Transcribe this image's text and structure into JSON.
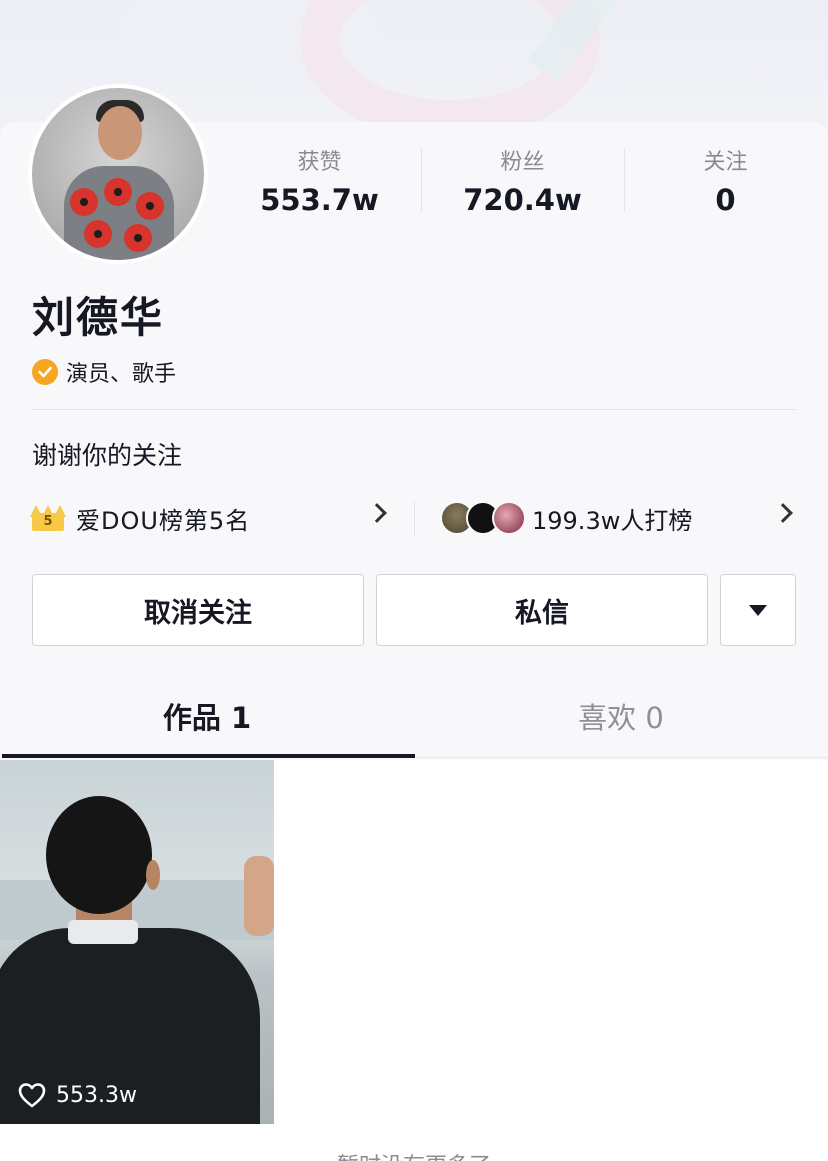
{
  "profile": {
    "name": "刘德华",
    "verification": "演员、歌手",
    "bio": "谢谢你的关注"
  },
  "stats": [
    {
      "label": "获赞",
      "value": "553.7w"
    },
    {
      "label": "粉丝",
      "value": "720.4w"
    },
    {
      "label": "关注",
      "value": "0"
    }
  ],
  "rank": {
    "badge_number": "5",
    "text": "爱DOU榜第5名",
    "supporters": "199.3w人打榜"
  },
  "actions": {
    "unfollow": "取消关注",
    "message": "私信"
  },
  "tabs": {
    "works": "作品 1",
    "likes": "喜欢 0"
  },
  "videos": [
    {
      "likes": "553.3w"
    }
  ],
  "footer": {
    "no_more": "暂时没有更多了"
  },
  "colors": {
    "verify_badge": "#f5a623",
    "crown": "#f7c948",
    "text_primary": "#161823",
    "text_secondary": "#8a8b91"
  },
  "icons": {
    "verify": "verified-check-icon",
    "crown": "crown-icon",
    "chevron": "chevron-right-icon",
    "more": "triangle-down-icon",
    "heart": "heart-outline-icon"
  }
}
